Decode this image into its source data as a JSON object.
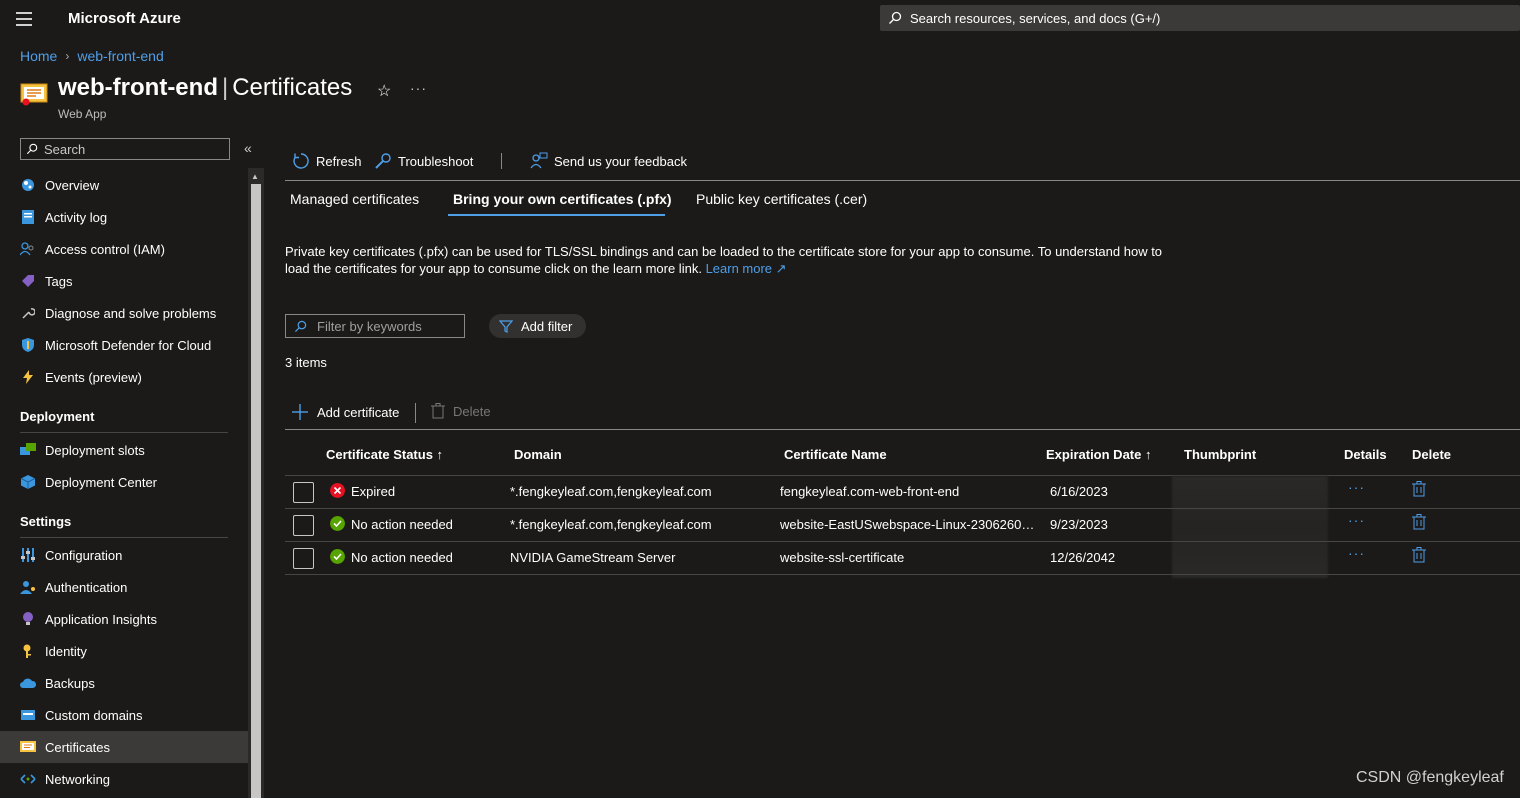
{
  "topbar": {
    "brand": "Microsoft Azure",
    "search_placeholder": "Search resources, services, and docs (G+/)"
  },
  "breadcrumb": {
    "home": "Home",
    "current": "web-front-end"
  },
  "header": {
    "resource": "web-front-end",
    "separator": "|",
    "blade": "Certificates",
    "subtitle": "Web App"
  },
  "sidebar": {
    "search_placeholder": "Search",
    "items": [
      {
        "label": "Overview",
        "icon": "globe-icon"
      },
      {
        "label": "Activity log",
        "icon": "log-icon"
      },
      {
        "label": "Access control (IAM)",
        "icon": "people-icon"
      },
      {
        "label": "Tags",
        "icon": "tag-icon"
      },
      {
        "label": "Diagnose and solve problems",
        "icon": "wrench-icon"
      },
      {
        "label": "Microsoft Defender for Cloud",
        "icon": "shield-icon"
      },
      {
        "label": "Events (preview)",
        "icon": "lightning-icon"
      }
    ],
    "deployment_heading": "Deployment",
    "deployment_items": [
      {
        "label": "Deployment slots",
        "icon": "slots-icon"
      },
      {
        "label": "Deployment Center",
        "icon": "cube-icon"
      }
    ],
    "settings_heading": "Settings",
    "settings_items": [
      {
        "label": "Configuration",
        "icon": "sliders-icon"
      },
      {
        "label": "Authentication",
        "icon": "user-key-icon"
      },
      {
        "label": "Application Insights",
        "icon": "bulb-icon"
      },
      {
        "label": "Identity",
        "icon": "key-icon"
      },
      {
        "label": "Backups",
        "icon": "cloud-icon"
      },
      {
        "label": "Custom domains",
        "icon": "domain-icon"
      },
      {
        "label": "Certificates",
        "icon": "certificate-icon",
        "active": true
      },
      {
        "label": "Networking",
        "icon": "network-icon"
      }
    ]
  },
  "toolbar": {
    "refresh": "Refresh",
    "troubleshoot": "Troubleshoot",
    "feedback": "Send us your feedback"
  },
  "tabs": [
    {
      "label": "Managed certificates"
    },
    {
      "label": "Bring your own certificates (.pfx)",
      "active": true
    },
    {
      "label": "Public key certificates (.cer)"
    }
  ],
  "description": {
    "text": "Private key certificates (.pfx) can be used for TLS/SSL bindings and can be loaded to the certificate store for your app to consume. To understand how to load the certificates for your app to consume click on the learn more link.",
    "link": "Learn more"
  },
  "filter": {
    "placeholder": "Filter by keywords",
    "add_filter": "Add filter"
  },
  "count": "3 items",
  "actions": {
    "add": "Add certificate",
    "delete": "Delete"
  },
  "table": {
    "headers": {
      "status": "Certificate Status",
      "status_sort": "↑",
      "domain": "Domain",
      "name": "Certificate Name",
      "expiration": "Expiration Date",
      "expiration_sort": "↑",
      "thumbprint": "Thumbprint",
      "details": "Details",
      "delete": "Delete"
    },
    "rows": [
      {
        "status": "Expired",
        "status_type": "error",
        "domain": "*.fengkeyleaf.com,fengkeyleaf.com",
        "name": "fengkeyleaf.com-web-front-end",
        "expiration": "6/16/2023"
      },
      {
        "status": "No action needed",
        "status_type": "ok",
        "domain": "*.fengkeyleaf.com,fengkeyleaf.com",
        "name": "website-EastUSwebspace-Linux-2306260…",
        "expiration": "9/23/2023"
      },
      {
        "status": "No action needed",
        "status_type": "ok",
        "domain": "NVIDIA GameStream Server",
        "name": "website-ssl-certificate",
        "expiration": "12/26/2042"
      }
    ]
  },
  "watermark": "CSDN @fengkeyleaf",
  "colors": {
    "accent": "#4f9fe8",
    "error": "#e81123",
    "success": "#57a300",
    "background": "#1b1a19"
  }
}
